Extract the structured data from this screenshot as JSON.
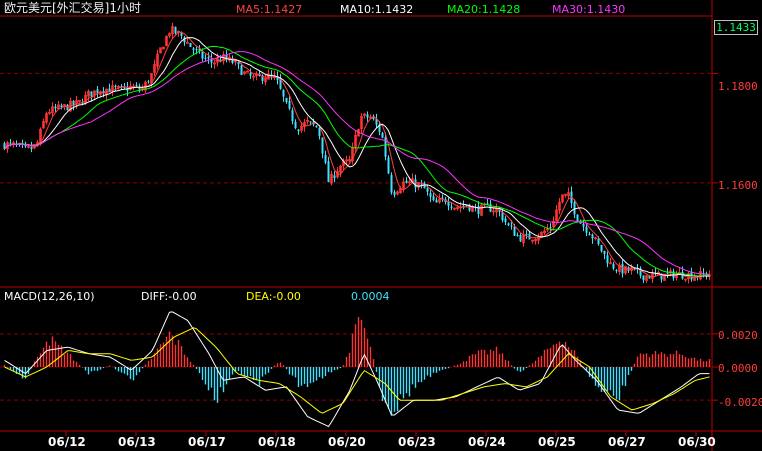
{
  "window": {
    "title": "欧元美元[外汇交易]1小时"
  },
  "legend": {
    "ma5": {
      "label": "MA5:1.1427",
      "color": "#ff4040"
    },
    "ma10": {
      "label": "MA10:1.1432",
      "color": "#ffffff"
    },
    "ma20": {
      "label": "MA20:1.1428",
      "color": "#00ff00"
    },
    "ma30": {
      "label": "MA30:1.1430",
      "color": "#ff33ff"
    }
  },
  "last_price": "1.1433",
  "macd_legend": {
    "name": "MACD(12,26,10)",
    "diff": "DIFF:-0.00",
    "dea": "DEA:-0.00",
    "macd": "0.0004"
  },
  "colors": {
    "up": "#ff3333",
    "down": "#40e0ff",
    "grid": "#8b0000",
    "axis": "#c00000",
    "diff": "#ffffff",
    "dea": "#ffff00"
  },
  "chart_data": [
    {
      "type": "candlestick",
      "title": "",
      "xlabel": "",
      "ylabel": "",
      "x_ticks": [
        "06/12",
        "06/13",
        "06/17",
        "06/18",
        "06/20",
        "06/23",
        "06/24",
        "06/25",
        "06/27",
        "06/30"
      ],
      "y_ticks": [
        "1.1800",
        "1.1600"
      ],
      "ylim": [
        1.1415,
        1.1905
      ],
      "close_path": [
        [
          0,
          1.167
        ],
        [
          0.015,
          1.1668
        ],
        [
          0.03,
          1.166
        ],
        [
          0.045,
          1.1665
        ],
        [
          0.06,
          1.173
        ],
        [
          0.075,
          1.1735
        ],
        [
          0.09,
          1.174
        ],
        [
          0.105,
          1.1745
        ],
        [
          0.12,
          1.1762
        ],
        [
          0.135,
          1.177
        ],
        [
          0.15,
          1.1772
        ],
        [
          0.165,
          1.177
        ],
        [
          0.18,
          1.1775
        ],
        [
          0.195,
          1.177
        ],
        [
          0.21,
          1.18
        ],
        [
          0.22,
          1.184
        ],
        [
          0.235,
          1.188
        ],
        [
          0.25,
          1.187
        ],
        [
          0.265,
          1.1848
        ],
        [
          0.28,
          1.183
        ],
        [
          0.295,
          1.182
        ],
        [
          0.31,
          1.1828
        ],
        [
          0.325,
          1.182
        ],
        [
          0.34,
          1.18
        ],
        [
          0.355,
          1.179
        ],
        [
          0.37,
          1.1795
        ],
        [
          0.385,
          1.179
        ],
        [
          0.4,
          1.174
        ],
        [
          0.415,
          1.17
        ],
        [
          0.43,
          1.171
        ],
        [
          0.445,
          1.17
        ],
        [
          0.46,
          1.16
        ],
        [
          0.475,
          1.163
        ],
        [
          0.49,
          1.164
        ],
        [
          0.505,
          1.172
        ],
        [
          0.52,
          1.172
        ],
        [
          0.535,
          1.169
        ],
        [
          0.55,
          1.158
        ],
        [
          0.565,
          1.16
        ],
        [
          0.58,
          1.16
        ],
        [
          0.595,
          1.159
        ],
        [
          0.61,
          1.156
        ],
        [
          0.625,
          1.157
        ],
        [
          0.64,
          1.1555
        ],
        [
          0.655,
          1.156
        ],
        [
          0.67,
          1.155
        ],
        [
          0.685,
          1.1555
        ],
        [
          0.7,
          1.155
        ],
        [
          0.715,
          1.152
        ],
        [
          0.73,
          1.15
        ],
        [
          0.745,
          1.15
        ],
        [
          0.76,
          1.1505
        ],
        [
          0.775,
          1.152
        ],
        [
          0.79,
          1.1575
        ],
        [
          0.8,
          1.1575
        ],
        [
          0.815,
          1.153
        ],
        [
          0.83,
          1.151
        ],
        [
          0.845,
          1.148
        ],
        [
          0.86,
          1.145
        ],
        [
          0.875,
          1.144
        ],
        [
          0.89,
          1.144
        ],
        [
          0.905,
          1.143
        ],
        [
          0.92,
          1.143
        ],
        [
          0.935,
          1.143
        ],
        [
          0.95,
          1.1433
        ],
        [
          0.965,
          1.1432
        ],
        [
          0.98,
          1.143
        ],
        [
          1.0,
          1.1433
        ]
      ]
    },
    {
      "type": "bar",
      "title": "",
      "name": "MACD(12,26,10)",
      "y_ticks": [
        "0.0020",
        "0.0000",
        "-0.0020"
      ],
      "ylim": [
        -0.0038,
        0.0038
      ],
      "hist_path": [
        [
          0,
          0.0001
        ],
        [
          0.03,
          -0.0008
        ],
        [
          0.06,
          0.0018
        ],
        [
          0.09,
          0.0008
        ],
        [
          0.12,
          -0.0004
        ],
        [
          0.15,
          0.0001
        ],
        [
          0.18,
          -0.0008
        ],
        [
          0.21,
          0.0006
        ],
        [
          0.235,
          0.002
        ],
        [
          0.25,
          0.0012
        ],
        [
          0.28,
          -0.0006
        ],
        [
          0.3,
          -0.002
        ],
        [
          0.33,
          -0.0002
        ],
        [
          0.36,
          -0.001
        ],
        [
          0.39,
          0.0004
        ],
        [
          0.42,
          -0.0012
        ],
        [
          0.45,
          -0.0006
        ],
        [
          0.48,
          0.0
        ],
        [
          0.505,
          0.003
        ],
        [
          0.52,
          0.001
        ],
        [
          0.535,
          -0.0016
        ],
        [
          0.55,
          -0.0026
        ],
        [
          0.58,
          -0.0012
        ],
        [
          0.61,
          -0.0004
        ],
        [
          0.64,
          0.0001
        ],
        [
          0.67,
          0.0008
        ],
        [
          0.7,
          0.001
        ],
        [
          0.73,
          -0.0004
        ],
        [
          0.76,
          0.0006
        ],
        [
          0.79,
          0.0018
        ],
        [
          0.81,
          0.0008
        ],
        [
          0.84,
          -0.0012
        ],
        [
          0.87,
          -0.002
        ],
        [
          0.9,
          0.0008
        ],
        [
          0.93,
          0.0008
        ],
        [
          0.96,
          0.0008
        ],
        [
          0.985,
          0.0004
        ],
        [
          1.0,
          0.0004
        ]
      ],
      "diff_path": [
        [
          0,
          0.0004
        ],
        [
          0.03,
          -0.0004
        ],
        [
          0.06,
          0.001
        ],
        [
          0.09,
          0.0012
        ],
        [
          0.12,
          0.0008
        ],
        [
          0.15,
          0.0006
        ],
        [
          0.18,
          -0.0002
        ],
        [
          0.21,
          0.001
        ],
        [
          0.235,
          0.0034
        ],
        [
          0.26,
          0.0028
        ],
        [
          0.29,
          0.0008
        ],
        [
          0.31,
          -0.0008
        ],
        [
          0.34,
          -0.0006
        ],
        [
          0.37,
          -0.0014
        ],
        [
          0.4,
          -0.0012
        ],
        [
          0.43,
          -0.003
        ],
        [
          0.46,
          -0.0036
        ],
        [
          0.49,
          -0.0014
        ],
        [
          0.51,
          0.0008
        ],
        [
          0.53,
          -0.001
        ],
        [
          0.55,
          -0.003
        ],
        [
          0.58,
          -0.002
        ],
        [
          0.61,
          -0.002
        ],
        [
          0.64,
          -0.0018
        ],
        [
          0.67,
          -0.0012
        ],
        [
          0.7,
          -0.0006
        ],
        [
          0.73,
          -0.0014
        ],
        [
          0.76,
          -0.001
        ],
        [
          0.79,
          0.0014
        ],
        [
          0.81,
          0.0004
        ],
        [
          0.84,
          -0.0008
        ],
        [
          0.87,
          -0.0026
        ],
        [
          0.9,
          -0.0028
        ],
        [
          0.93,
          -0.002
        ],
        [
          0.96,
          -0.0012
        ],
        [
          0.985,
          -0.0004
        ],
        [
          1.0,
          -0.0004
        ]
      ],
      "dea_path": [
        [
          0,
          0.0
        ],
        [
          0.03,
          -0.0006
        ],
        [
          0.06,
          0.0
        ],
        [
          0.09,
          0.001
        ],
        [
          0.12,
          0.0008
        ],
        [
          0.15,
          0.0008
        ],
        [
          0.18,
          0.0004
        ],
        [
          0.21,
          0.0006
        ],
        [
          0.24,
          0.0018
        ],
        [
          0.27,
          0.0024
        ],
        [
          0.3,
          0.0012
        ],
        [
          0.33,
          -0.0004
        ],
        [
          0.36,
          -0.0008
        ],
        [
          0.39,
          -0.001
        ],
        [
          0.42,
          -0.0018
        ],
        [
          0.45,
          -0.0028
        ],
        [
          0.48,
          -0.0022
        ],
        [
          0.51,
          -0.0002
        ],
        [
          0.54,
          -0.001
        ],
        [
          0.56,
          -0.002
        ],
        [
          0.59,
          -0.002
        ],
        [
          0.62,
          -0.002
        ],
        [
          0.65,
          -0.0016
        ],
        [
          0.68,
          -0.0012
        ],
        [
          0.71,
          -0.001
        ],
        [
          0.74,
          -0.0012
        ],
        [
          0.77,
          -0.0006
        ],
        [
          0.8,
          0.0008
        ],
        [
          0.83,
          0.0
        ],
        [
          0.86,
          -0.0018
        ],
        [
          0.89,
          -0.0026
        ],
        [
          0.92,
          -0.0022
        ],
        [
          0.95,
          -0.0016
        ],
        [
          0.98,
          -0.0008
        ],
        [
          1.0,
          -0.0006
        ]
      ]
    }
  ]
}
